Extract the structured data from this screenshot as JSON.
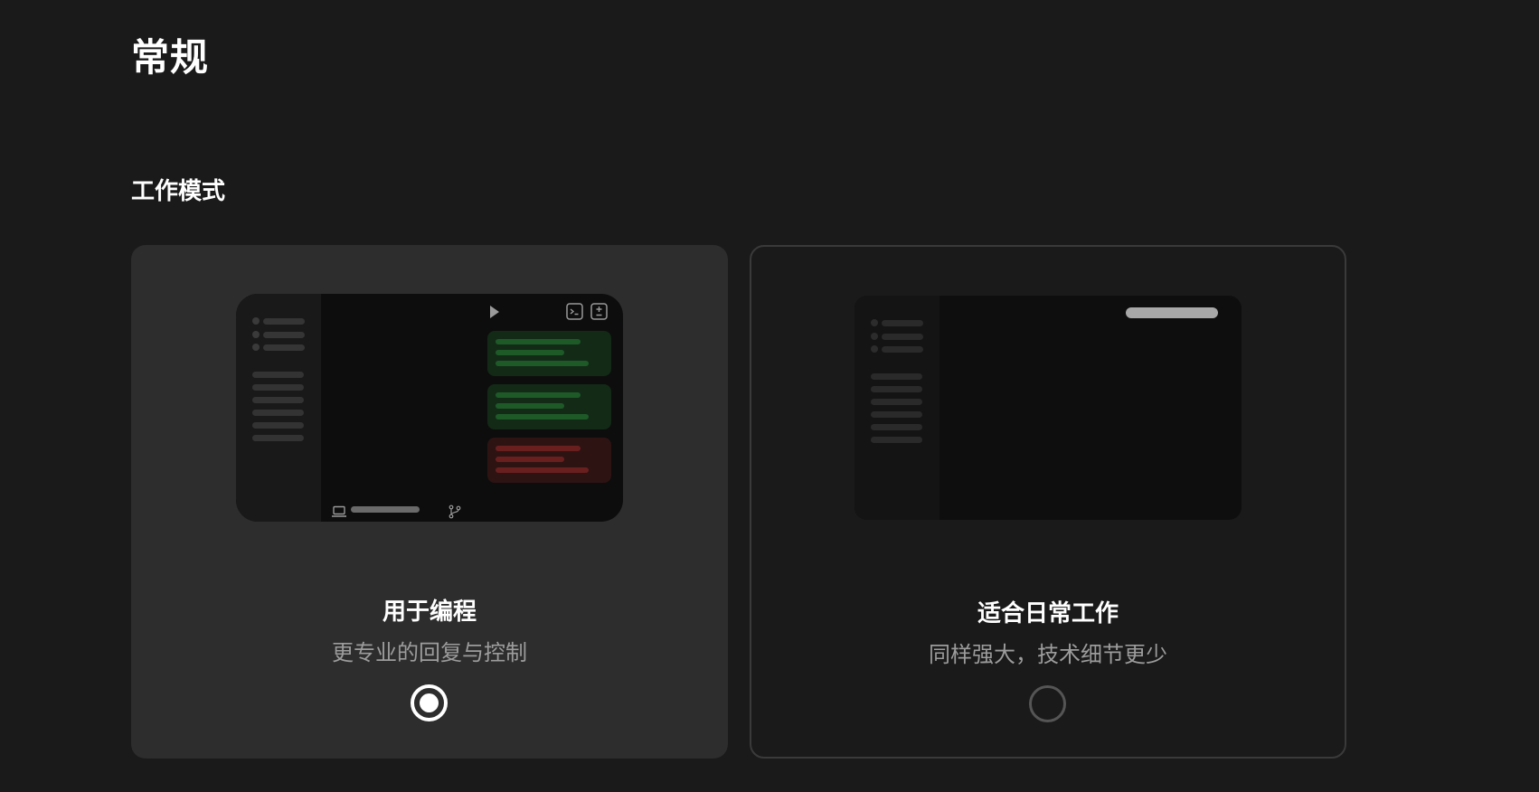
{
  "page": {
    "title": "常规"
  },
  "section": {
    "title": "工作模式"
  },
  "modes": [
    {
      "title": "用于编程",
      "subtitle": "更专业的回复与控制",
      "selected": true,
      "preview_icons": [
        "play-icon",
        "terminal-icon",
        "diff-icon",
        "laptop-icon",
        "git-branch-icon"
      ],
      "preview_bubbles": [
        "green",
        "green",
        "red"
      ]
    },
    {
      "title": "适合日常工作",
      "subtitle": "同样强大，技术细节更少",
      "selected": false
    }
  ],
  "colors": {
    "background": "#1a1a1a",
    "selected_card": "#2d2d2d",
    "text_primary": "#ffffff",
    "text_secondary": "#9c9c9c",
    "bubble_green": "#132a17",
    "bubble_red": "#2e1313"
  }
}
